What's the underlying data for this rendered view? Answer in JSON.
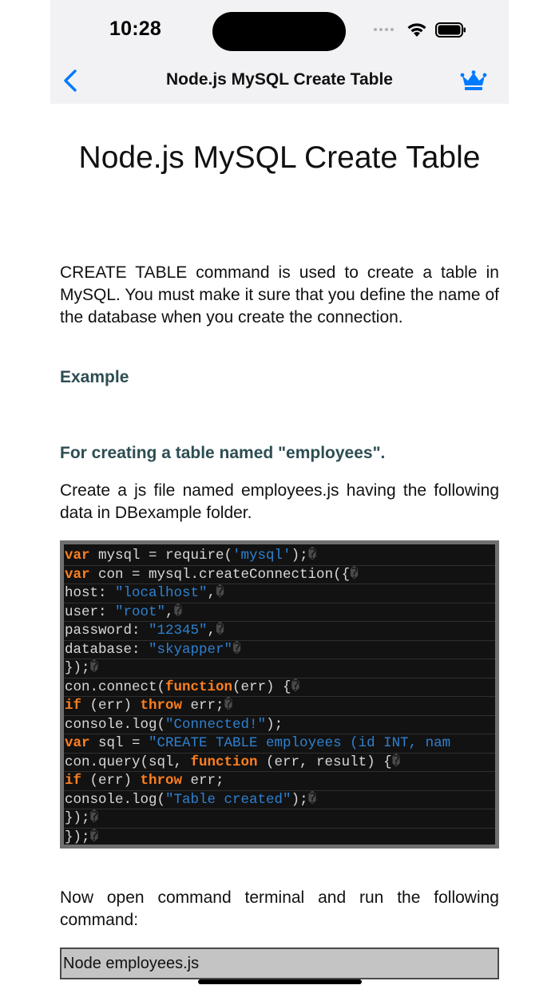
{
  "status": {
    "time": "10:28"
  },
  "nav": {
    "title": "Node.js MySQL Create Table"
  },
  "page": {
    "title": "Node.js MySQL Create Table",
    "intro": "CREATE TABLE command is used to create a table in MySQL. You must make it sure that you define the name of the database when you create the connection.",
    "example_heading": "Example",
    "sub_heading": "For creating a table named \"employees\".",
    "instruction": "Create a js file named employees.js having the following data in DBexample folder.",
    "run_text": "Now open command terminal and run the following command:",
    "command": "Node employees.js"
  },
  "code": {
    "glyph": "�",
    "lines": [
      [
        {
          "t": "var",
          "c": "kw"
        },
        {
          "t": " mysql = require(",
          "c": "pl"
        },
        {
          "t": "'mysql'",
          "c": "str"
        },
        {
          "t": ");",
          "c": "pl"
        }
      ],
      [
        {
          "t": "var",
          "c": "kw"
        },
        {
          "t": " con = mysql.createConnection({",
          "c": "pl"
        }
      ],
      [
        {
          "t": "host: ",
          "c": "pl"
        },
        {
          "t": "\"localhost\"",
          "c": "str"
        },
        {
          "t": ",",
          "c": "pl"
        }
      ],
      [
        {
          "t": "user: ",
          "c": "pl"
        },
        {
          "t": "\"root\"",
          "c": "str"
        },
        {
          "t": ",",
          "c": "pl"
        }
      ],
      [
        {
          "t": "password: ",
          "c": "pl"
        },
        {
          "t": "\"12345\"",
          "c": "str"
        },
        {
          "t": ",",
          "c": "pl"
        }
      ],
      [
        {
          "t": "database: ",
          "c": "pl"
        },
        {
          "t": "\"skyapper\"",
          "c": "str"
        }
      ],
      [
        {
          "t": "});",
          "c": "pl"
        }
      ],
      [
        {
          "t": "con.connect(",
          "c": "pl"
        },
        {
          "t": "function",
          "c": "kw"
        },
        {
          "t": "(err) {",
          "c": "pl"
        }
      ],
      [
        {
          "t": "if",
          "c": "kw"
        },
        {
          "t": " (err) ",
          "c": "pl"
        },
        {
          "t": "throw",
          "c": "kw"
        },
        {
          "t": " err;",
          "c": "pl"
        }
      ],
      [
        {
          "t": "console.log(",
          "c": "pl"
        },
        {
          "t": "\"Connected!\"",
          "c": "str"
        },
        {
          "t": ");",
          "c": "pl"
        }
      ],
      [
        {
          "t": "var",
          "c": "kw"
        },
        {
          "t": " sql = ",
          "c": "pl"
        },
        {
          "t": "\"CREATE TABLE employees (id INT, nam",
          "c": "str"
        }
      ],
      [
        {
          "t": "con.query(sql, ",
          "c": "pl"
        },
        {
          "t": "function",
          "c": "kw"
        },
        {
          "t": " (err, result) {",
          "c": "pl"
        }
      ],
      [
        {
          "t": "if",
          "c": "kw"
        },
        {
          "t": " (err) ",
          "c": "pl"
        },
        {
          "t": "throw",
          "c": "kw"
        },
        {
          "t": " err;",
          "c": "pl"
        }
      ],
      [
        {
          "t": "console.log(",
          "c": "pl"
        },
        {
          "t": "\"Table created\"",
          "c": "str"
        },
        {
          "t": ");",
          "c": "pl"
        }
      ],
      [
        {
          "t": "});",
          "c": "pl"
        }
      ],
      [
        {
          "t": "});",
          "c": "pl"
        }
      ]
    ],
    "line_glyph": [
      true,
      true,
      true,
      true,
      true,
      true,
      true,
      true,
      true,
      false,
      false,
      true,
      false,
      true,
      true,
      true
    ]
  },
  "colors": {
    "accent": "#007aff",
    "heading": "#2d4d52",
    "code_keyword": "#ff7f1f",
    "code_string": "#2f80d0",
    "code_bg": "#121212"
  },
  "icons": {
    "back": "chevron-left-icon",
    "premium": "crown-icon",
    "wifi": "wifi-icon",
    "battery": "battery-icon"
  }
}
